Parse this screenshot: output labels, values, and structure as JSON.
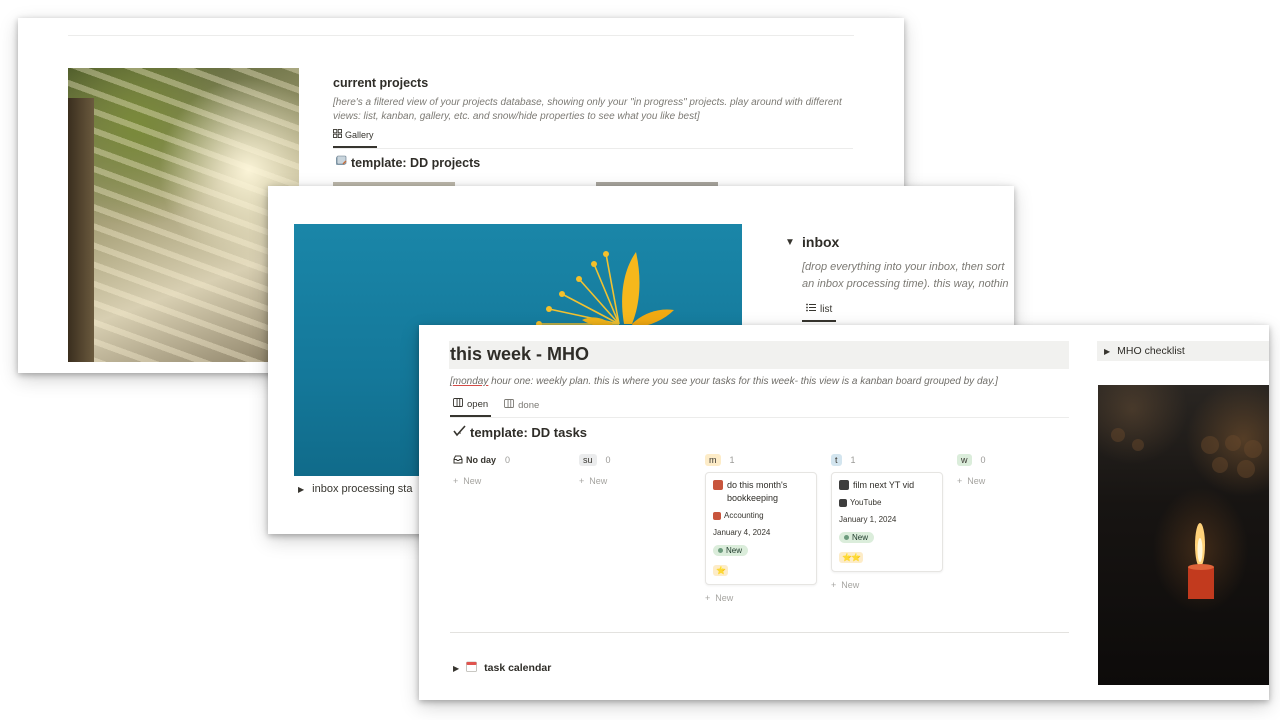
{
  "card1": {
    "section_title": "current projects",
    "description": "[here's a filtered view of your projects database, showing only your \"in progress\" projects. play around with different views: list, kanban, gallery, etc. and snow/hide properties to see what you like best]",
    "view_tab": "Gallery",
    "db_title": "template: DD projects"
  },
  "card2": {
    "inbox_title": "inbox",
    "inbox_desc_line1": "[drop everything into your inbox, then sort",
    "inbox_desc_line2": "an inbox processing time). this way, nothin",
    "view_tab": "list",
    "processing_toggle": "inbox processing sta"
  },
  "card3": {
    "title": "this week - MHO",
    "desc_underlined": "monday",
    "desc_rest": " hour one: weekly plan. this is where you see your tasks for this week- this view is a kanban board grouped by day.",
    "desc_open": "[",
    "desc_close": "]",
    "tabs": [
      {
        "label": "open",
        "active": true
      },
      {
        "label": "done",
        "active": false
      }
    ],
    "db_title": "template: DD tasks",
    "new_label": "New",
    "columns": [
      {
        "label": "No day",
        "count": "0",
        "color": "#ffffff"
      },
      {
        "label": "su",
        "count": "0",
        "color": "#ebeced"
      },
      {
        "label": "m",
        "count": "1",
        "color": "#fdecc8"
      },
      {
        "label": "t",
        "count": "1",
        "color": "#d3e5ef"
      },
      {
        "label": "w",
        "count": "0",
        "color": "#dbeddb"
      }
    ],
    "cards": [
      {
        "title": "do this month's bookkeeping",
        "tag": "Accounting",
        "date": "January 4, 2024",
        "status": "New",
        "stars": "⭐"
      },
      {
        "title": "film next YT vid",
        "tag": "YouTube",
        "date": "January 1, 2024",
        "status": "New",
        "stars": "⭐⭐"
      }
    ],
    "calendar_toggle": "task calendar",
    "checklist_toggle": "MHO checklist"
  },
  "icons": [
    "gallery-icon",
    "projects-icon",
    "list-icon",
    "board-icon",
    "tasks-check-icon",
    "inbox-tray-icon",
    "calendar-icon",
    "toggle-triangle-icon",
    "plus-icon"
  ]
}
